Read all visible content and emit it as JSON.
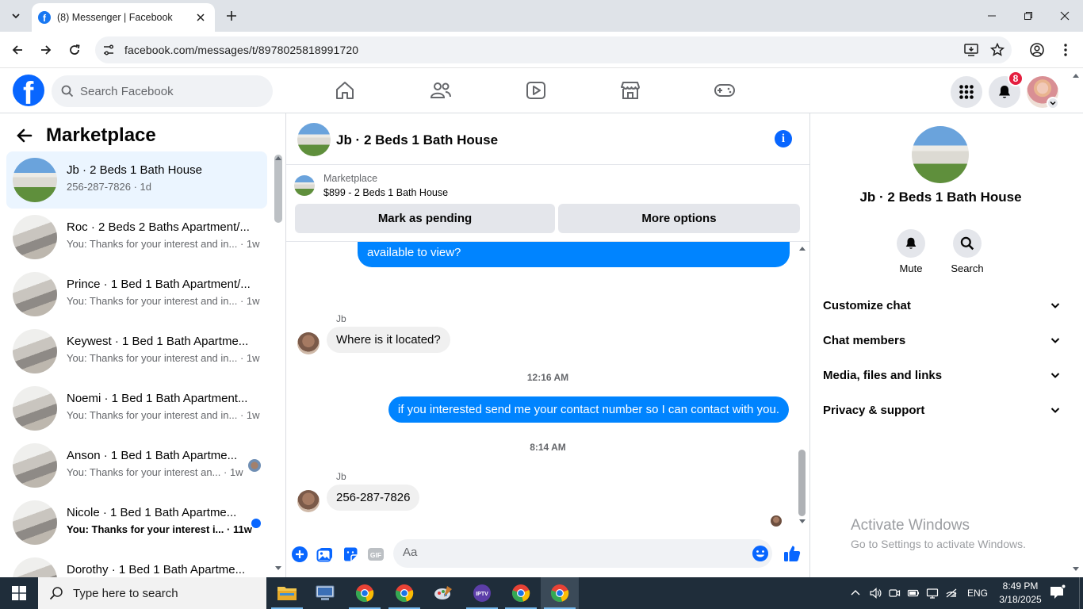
{
  "browser": {
    "tab_title": "(8) Messenger | Facebook",
    "url": "facebook.com/messages/t/8978025818991720"
  },
  "fb": {
    "search_placeholder": "Search Facebook",
    "notification_count": "8"
  },
  "left": {
    "title": "Marketplace",
    "conversations": [
      {
        "name": "Jb · 2 Beds 1 Bath House",
        "preview": "256-287-7826 · 1d",
        "active": true,
        "thumb": "house"
      },
      {
        "name": "Roc · 2 Beds 2 Baths Apartment/...",
        "preview": "You: Thanks for your interest and in... · 1w",
        "thumb": "apt"
      },
      {
        "name": "Prince · 1 Bed 1 Bath Apartment/...",
        "preview": "You: Thanks for your interest and in... · 1w",
        "thumb": "apt"
      },
      {
        "name": "Keywest · 1 Bed 1 Bath Apartme...",
        "preview": "You: Thanks for your interest and in... · 1w",
        "thumb": "apt"
      },
      {
        "name": "Noemi · 1 Bed 1 Bath Apartment...",
        "preview": "You: Thanks for your interest and in... · 1w",
        "thumb": "apt"
      },
      {
        "name": "Anson · 1 Bed 1 Bath Apartme...",
        "preview": "You: Thanks for your interest an... · 1w",
        "thumb": "apt"
      },
      {
        "name": "Nicole · 1 Bed 1 Bath Apartme...",
        "preview": "You: Thanks for your interest i... · 11w",
        "thumb": "apt",
        "unread": true
      },
      {
        "name": "Dorothy · 1 Bed 1 Bath Apartme...",
        "preview": "",
        "thumb": "apt"
      }
    ]
  },
  "chat": {
    "title": "Jb · 2 Beds 1 Bath House",
    "marketplace_label": "Marketplace",
    "listing": "$899 - 2 Beds 1 Bath House",
    "mark_pending": "Mark as pending",
    "more_options": "More options",
    "messages": {
      "out_partial": "available to view?",
      "sender1": "Jb",
      "in1": "Where is it located?",
      "time1": "12:16 AM",
      "out1": "if you interested send me your contact number so I can contact with you.",
      "time2": "8:14 AM",
      "sender2": "Jb",
      "in2": "256-287-7826"
    },
    "composer_placeholder": "Aa"
  },
  "right": {
    "name": "Jb · 2 Beds 1 Bath House",
    "mute": "Mute",
    "search": "Search",
    "rows": [
      "Customize chat",
      "Chat members",
      "Media, files and links",
      "Privacy & support"
    ],
    "watermark_title": "Activate Windows",
    "watermark_sub": "Go to Settings to activate Windows."
  },
  "taskbar": {
    "search_text": "Type here to search",
    "lang": "ENG",
    "time": "8:49 PM",
    "date": "3/18/2025"
  }
}
